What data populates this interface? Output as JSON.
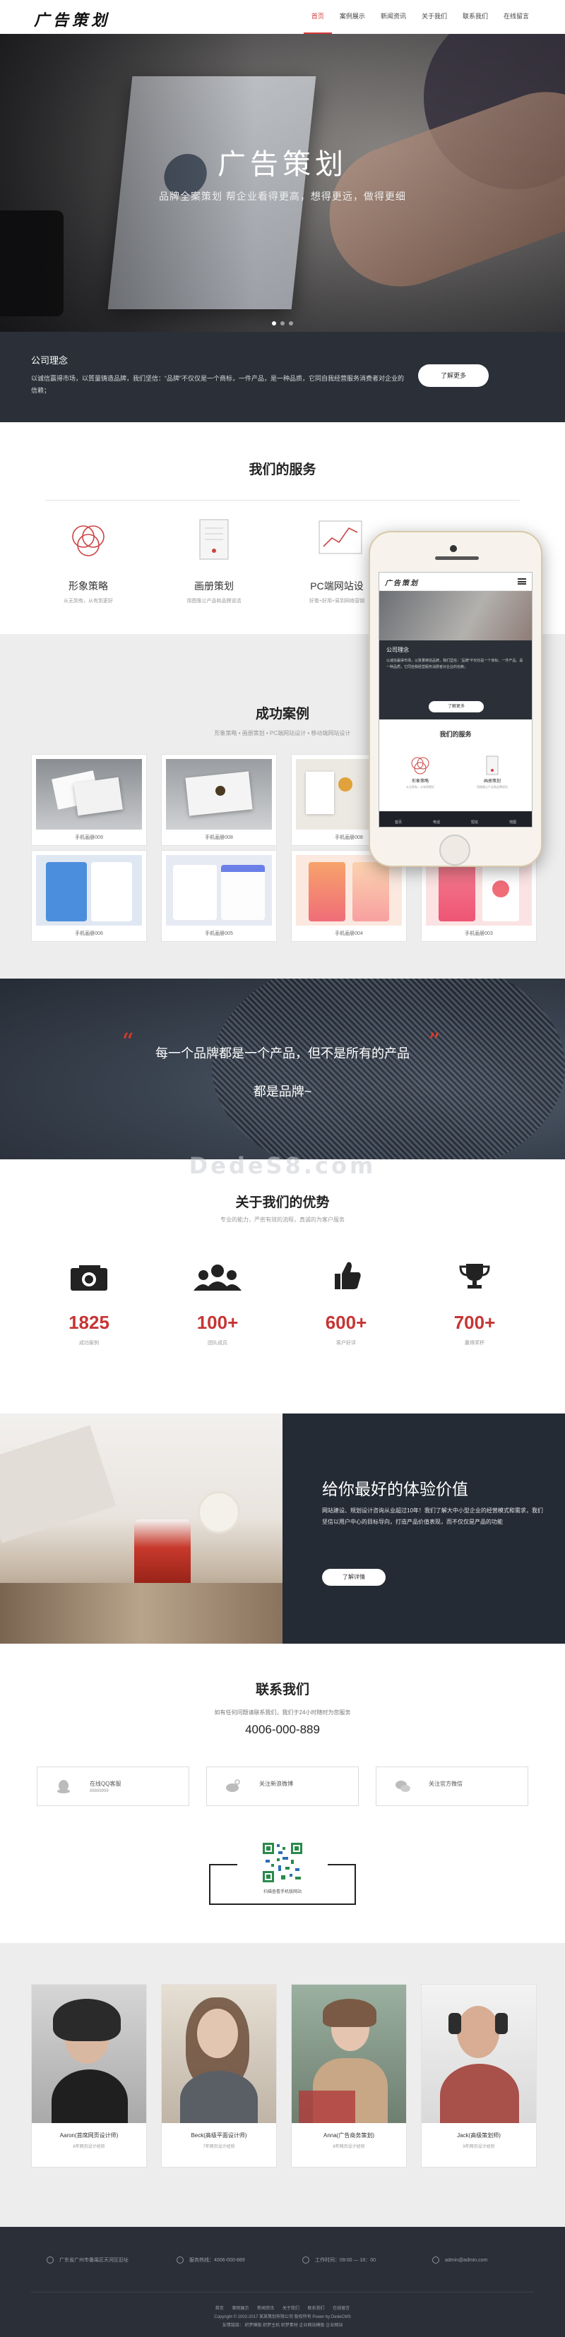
{
  "header": {
    "logo": "广告策划",
    "nav": [
      {
        "label": "首页",
        "active": true
      },
      {
        "label": "案例展示"
      },
      {
        "label": "新闻资讯"
      },
      {
        "label": "关于我们"
      },
      {
        "label": "联系我们"
      },
      {
        "label": "在线留言"
      }
    ]
  },
  "banner": {
    "title": "广告策划",
    "subtitle": "品牌全案策划 帮企业看得更高，想得更远，做得更细",
    "slide_count": 3,
    "active_slide": 1
  },
  "concept": {
    "title": "公司理念",
    "text": "以诚信赢得市场，以質量铸造品牌，我们坚信：“品牌”不仅仅是一个商标，一件产品，是一种品质，它同自我经营服务消费者对企业的信赖；",
    "button": "了解更多"
  },
  "services": {
    "title": "我们的服务",
    "items": [
      {
        "name": "形象策略",
        "desc": "从无到有，从有到更好",
        "icon": "venn-icon"
      },
      {
        "name": "画册策划",
        "desc": "用图像让产品和品牌说话",
        "icon": "brochure-icon"
      },
      {
        "name": "PC端网站设",
        "desc": "好看+好用+易到网络营销",
        "icon": "chart-icon"
      }
    ]
  },
  "cases": {
    "title": "成功案例",
    "subtitle": "形象策略 • 画册策划 • PC端网站设计 • 移动端网站设计",
    "items": [
      {
        "caption": "手机画册009"
      },
      {
        "caption": "手机画册008"
      },
      {
        "caption": "手机画册008"
      },
      {
        "caption": "手机画册006"
      },
      {
        "caption": "手机画册005"
      },
      {
        "caption": "手机画册004"
      },
      {
        "caption": "手机画册003"
      }
    ]
  },
  "phone_mock": {
    "logo": "广告策划",
    "concept_title": "公司理念",
    "concept_text": "以诚信赢得市场，以質量铸造品牌，我们坚信：“品牌”不仅仅是一个商标，一件产品，是一种品质，它同自我经营服务消费者对企业的信赖；",
    "button": "了解更多",
    "services_title": "我们的服务",
    "services": [
      {
        "name": "形象策略",
        "desc": "从无到有，从有到更好"
      },
      {
        "name": "画册策划",
        "desc": "用图像让产品和品牌说话"
      }
    ],
    "footer_tabs": [
      "首页",
      "电话",
      "短信",
      "地图"
    ]
  },
  "quote": {
    "line1": "每一个品牌都是一个产品，但不是所有的产品",
    "line2": "都是品牌~",
    "open_mark": "“",
    "close_mark": "”"
  },
  "watermark": "DedeS8.com",
  "advantages": {
    "title": "关于我们的优势",
    "subtitle": "专业的能力，严密有效的流程，真诚的为客户服务",
    "items": [
      {
        "number": "1825",
        "label": "成功案例",
        "icon": "camera-icon"
      },
      {
        "number": "100+",
        "label": "团队成员",
        "icon": "team-icon"
      },
      {
        "number": "600+",
        "label": "客户好评",
        "icon": "thumbs-up-icon"
      },
      {
        "number": "700+",
        "label": "赢得奖杯",
        "icon": "trophy-icon"
      }
    ]
  },
  "experience": {
    "title": "给你最好的体验价值",
    "text": "网站建设、规划设计咨询从业超过10年！我们了解大中小型企业的经营模式和需求，我们坚信以用户中心的目标导向，打造产品价值表现，而不仅仅是产品的功能",
    "button": "了解详情"
  },
  "contact": {
    "title": "联系我们",
    "subtitle": "如有任何问题请联系我们，我们于24小时随时为您服务",
    "phone": "4006-000-889",
    "boxes": [
      {
        "title": "在线QQ客服",
        "sub": "88889999",
        "icon": "qq-icon"
      },
      {
        "title": "关注新浪微博",
        "sub": "",
        "icon": "weibo-icon"
      },
      {
        "title": "关注官方微信",
        "sub": "",
        "icon": "wechat-icon"
      }
    ],
    "qr_caption": "扫描查看手机版网站"
  },
  "team": {
    "members": [
      {
        "name": "Aaron(首席网页设计师)",
        "desc": "6年网页设计经验"
      },
      {
        "name": "Beck(高级平面设计师)",
        "desc": "7年网页设计经验"
      },
      {
        "name": "Anna(广告商务策划)",
        "desc": "8年网页设计经验"
      },
      {
        "name": "Jack(高级策划师)",
        "desc": "9年网页设计经验"
      }
    ]
  },
  "footer": {
    "info": [
      {
        "text": "广东省广州市番禺区天河区旧址",
        "icon": "location-icon"
      },
      {
        "text": "服务热线：4006-000-889",
        "icon": "phone-icon"
      },
      {
        "text": "工作时间：09:00 — 18：00",
        "icon": "clock-icon"
      },
      {
        "text": "admin@admin.com",
        "icon": "mail-icon"
      }
    ],
    "nav": [
      "首页",
      "案例展示",
      "新闻资讯",
      "关于我们",
      "联系我们",
      "在线留言"
    ],
    "copyright": "Copyright © 2002-2017 某某策划有限公司 版权所有 Power by DedeCMS",
    "links_label": "友情链接：",
    "links": [
      "织梦模板",
      "织梦主机",
      "织梦素材",
      "企业网站模板",
      "企业网站"
    ]
  },
  "colors": {
    "accent": "#d23a3a",
    "dark": "#2b3038",
    "number_red": "#c63535"
  }
}
